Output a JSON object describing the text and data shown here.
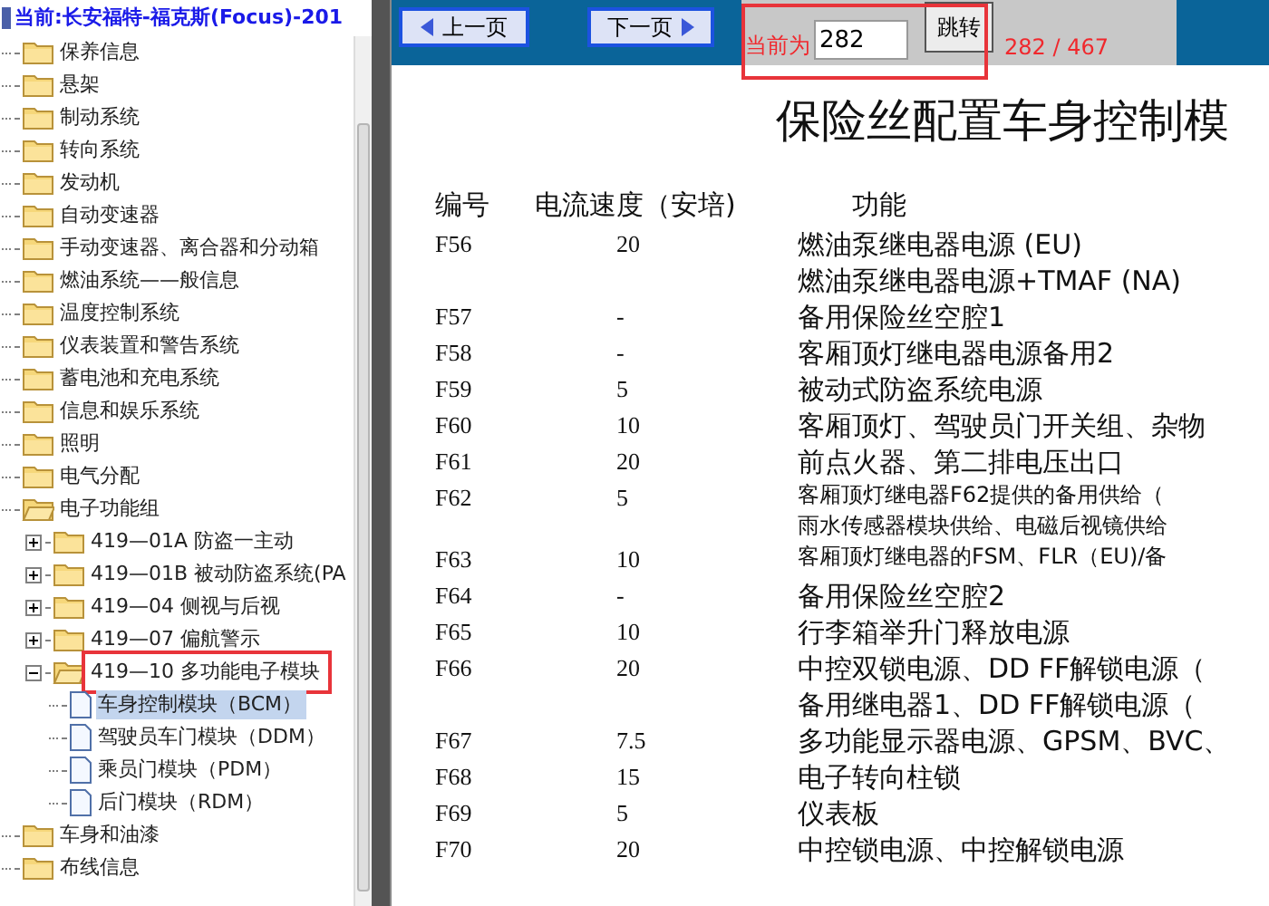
{
  "sidebar": {
    "root": "当前:长安福特-福克斯(Focus)-201",
    "items": [
      {
        "label": "保养信息",
        "kind": "folder",
        "expanded": false
      },
      {
        "label": "悬架",
        "kind": "folder",
        "expanded": false
      },
      {
        "label": "制动系统",
        "kind": "folder",
        "expanded": false
      },
      {
        "label": "转向系统",
        "kind": "folder",
        "expanded": false
      },
      {
        "label": "发动机",
        "kind": "folder",
        "expanded": false
      },
      {
        "label": "自动变速器",
        "kind": "folder",
        "expanded": false
      },
      {
        "label": "手动变速器、离合器和分动箱",
        "kind": "folder",
        "expanded": false
      },
      {
        "label": "燃油系统——般信息",
        "kind": "folder",
        "expanded": false
      },
      {
        "label": "温度控制系统",
        "kind": "folder",
        "expanded": false
      },
      {
        "label": "仪表装置和警告系统",
        "kind": "folder",
        "expanded": false
      },
      {
        "label": "蓄电池和充电系统",
        "kind": "folder",
        "expanded": false
      },
      {
        "label": "信息和娱乐系统",
        "kind": "folder",
        "expanded": false
      },
      {
        "label": "照明",
        "kind": "folder",
        "expanded": false
      },
      {
        "label": "电气分配",
        "kind": "folder",
        "expanded": false
      },
      {
        "label": "电子功能组",
        "kind": "folder",
        "expanded": true,
        "children": [
          {
            "label": "419—01A 防盗一主动",
            "kind": "folder",
            "expanded": false
          },
          {
            "label": "419—01B 被动防盗系统(PA",
            "kind": "folder",
            "expanded": false
          },
          {
            "label": "419—04 侧视与后视",
            "kind": "folder",
            "expanded": false
          },
          {
            "label": "419—07 偏航警示",
            "kind": "folder",
            "expanded": false
          },
          {
            "label": "419—10 多功能电子模块",
            "kind": "folder",
            "expanded": true,
            "highlighted": true,
            "children": [
              {
                "label": "车身控制模块（BCM）",
                "kind": "page",
                "selected": true
              },
              {
                "label": "驾驶员车门模块（DDM）",
                "kind": "page",
                "selected": false
              },
              {
                "label": "乘员门模块（PDM）",
                "kind": "page",
                "selected": false
              },
              {
                "label": "后门模块（RDM）",
                "kind": "page",
                "selected": false
              }
            ]
          }
        ]
      },
      {
        "label": "车身和油漆",
        "kind": "folder",
        "expanded": false
      },
      {
        "label": "布线信息",
        "kind": "folder",
        "expanded": false
      }
    ]
  },
  "toolbar": {
    "prev_button": "上一页",
    "next_button": "下一页",
    "current_label": "当前为",
    "page_field": "282",
    "go_button": "跳转",
    "page_count": "282 / 467",
    "highlighted": true
  },
  "document": {
    "title": "保险丝配置车身控制模",
    "columns": [
      "编号",
      "电流速度（安培)",
      "功能"
    ],
    "rows": [
      {
        "id": "F56",
        "current": "20",
        "functions": [
          "燃油泵继电器电源 (EU)",
          "燃油泵继电器电源+TMAF (NA)"
        ]
      },
      {
        "id": "F57",
        "current": "-",
        "functions": [
          "备用保险丝空腔1"
        ]
      },
      {
        "id": "F58",
        "current": "-",
        "functions": [
          "客厢顶灯继电器电源备用2"
        ]
      },
      {
        "id": "F59",
        "current": "5",
        "functions": [
          "被动式防盗系统电源"
        ]
      },
      {
        "id": "F60",
        "current": "10",
        "functions": [
          "客厢顶灯、驾驶员门开关组、杂物"
        ]
      },
      {
        "id": "F61",
        "current": "20",
        "functions": [
          "前点火器、第二排电压出口"
        ]
      },
      {
        "id": "F62",
        "current": "5",
        "small": true,
        "functions": [
          "客厢顶灯继电器F62提供的备用供给（",
          "雨水传感器模块供给、电磁后视镜供给"
        ]
      },
      {
        "id": "F63",
        "current": "10",
        "small": true,
        "functions": [
          "客厢顶灯继电器的FSM、FLR（EU)/备"
        ]
      },
      {
        "id": "F64",
        "current": "-",
        "functions": [
          "备用保险丝空腔2"
        ]
      },
      {
        "id": "F65",
        "current": "10",
        "functions": [
          "行李箱举升门释放电源"
        ]
      },
      {
        "id": "F66",
        "current": "20",
        "functions": [
          "中控双锁电源、DD FF解锁电源（",
          "备用继电器1、DD FF解锁电源（"
        ]
      },
      {
        "id": "F67",
        "current": "7.5",
        "functions": [
          "多功能显示器电源、GPSM、BVC、"
        ]
      },
      {
        "id": "F68",
        "current": "15",
        "functions": [
          "电子转向柱锁"
        ]
      },
      {
        "id": "F69",
        "current": "5",
        "functions": [
          "仪表板"
        ]
      },
      {
        "id": "F70",
        "current": "20",
        "functions": [
          "中控锁电源、中控解锁电源"
        ]
      }
    ]
  }
}
